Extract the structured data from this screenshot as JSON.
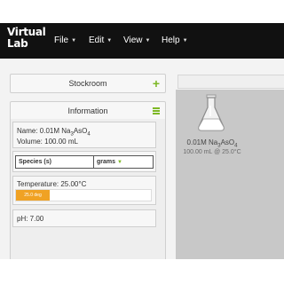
{
  "header": {
    "logo_line1": "Virtual",
    "logo_line2": "Lab",
    "menus": [
      {
        "label": "File"
      },
      {
        "label": "Edit"
      },
      {
        "label": "View"
      },
      {
        "label": "Help"
      }
    ]
  },
  "stockroom": {
    "title": "Stockroom"
  },
  "information": {
    "title": "Information",
    "name_prefix": "Name: 0.01M Na",
    "name_sub1": "3",
    "name_mid": "AsO",
    "name_sub2": "4",
    "volume": "Volume: 100.00 mL",
    "species_header": "Species (s)",
    "grams_header": "grams",
    "temperature": "Temperature: 25.00°C",
    "temp_bar_label": "25.0 deg",
    "ph": "pH: 7.00"
  },
  "workbench": {
    "flask": {
      "name_prefix": "0.01M Na",
      "name_sub1": "3",
      "name_mid": "AsO",
      "name_sub2": "4",
      "detail": "100.00 mL @ 25.0°C"
    }
  },
  "colors": {
    "accent": "#7db825",
    "temp_bar": "#f0a224",
    "topbar": "#111111"
  }
}
